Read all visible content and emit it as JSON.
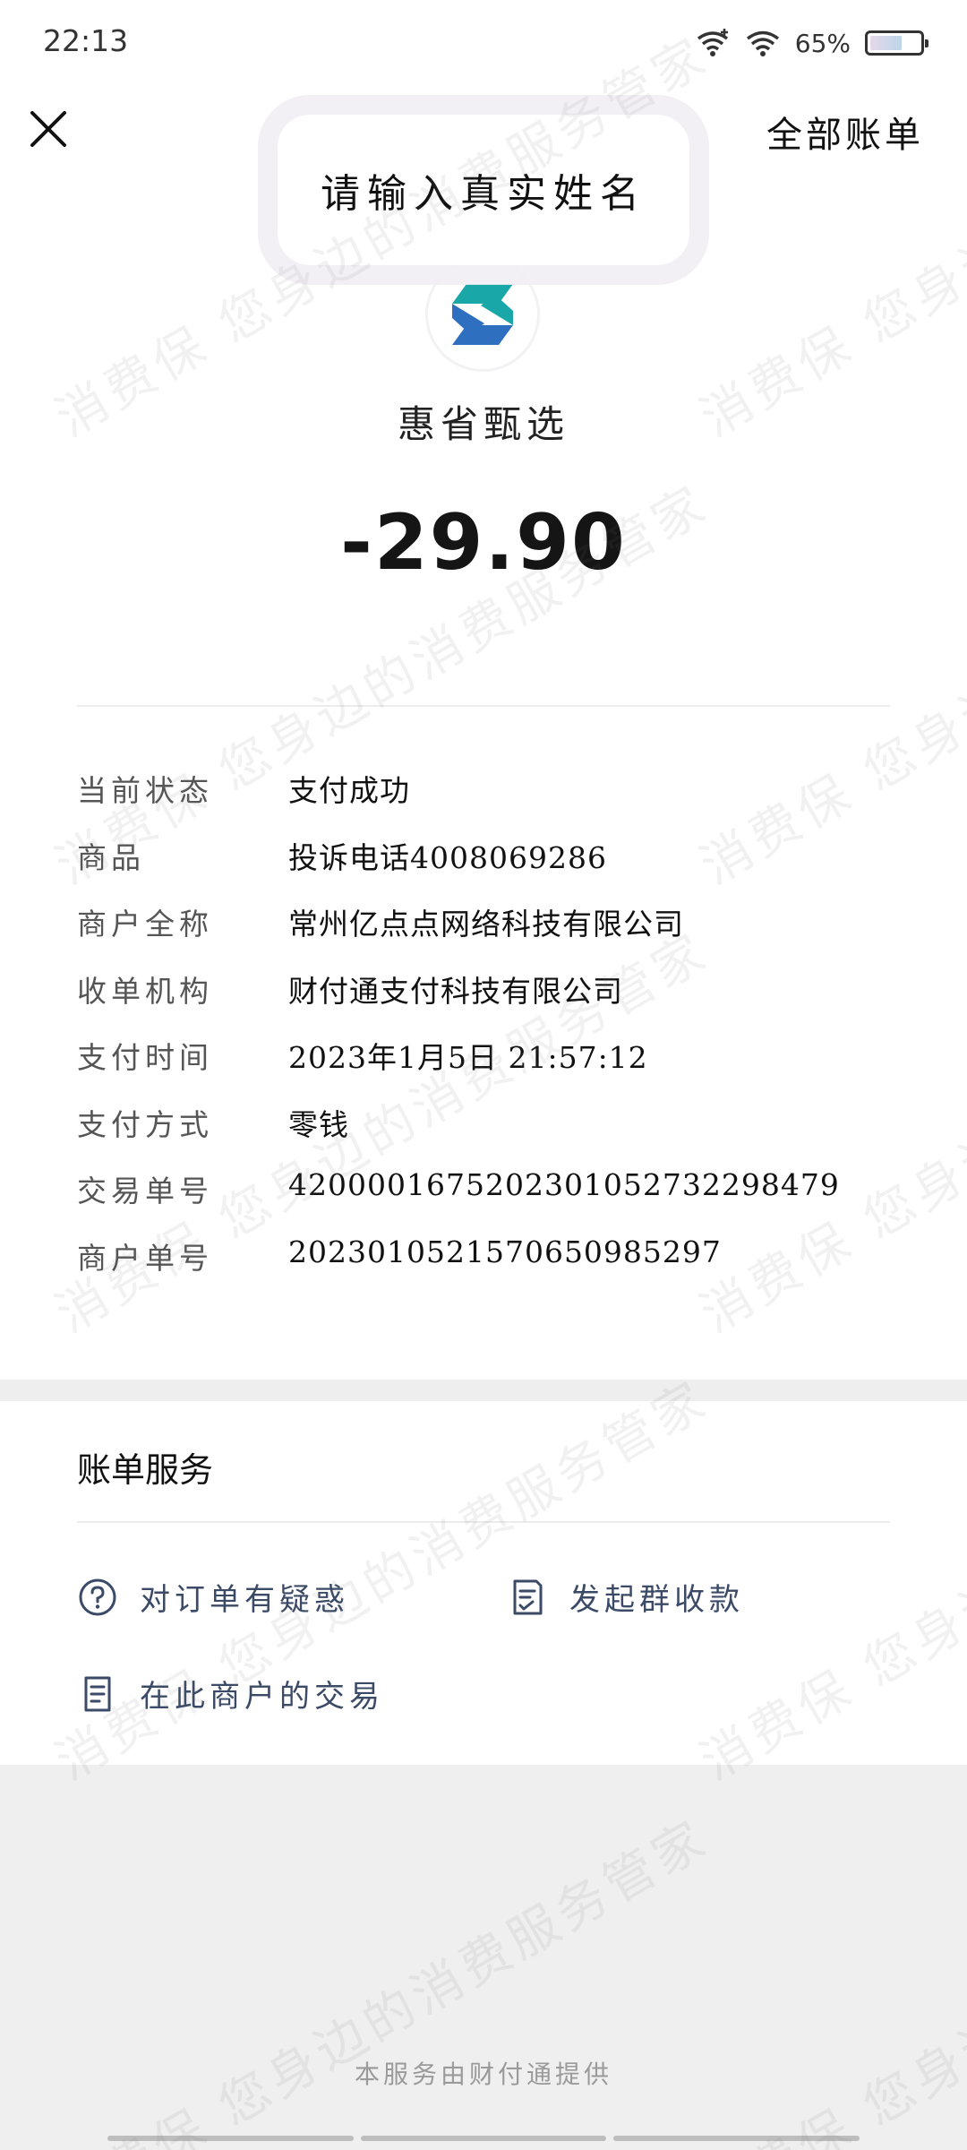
{
  "status_bar": {
    "time": "22:13",
    "battery_percent": "65%",
    "battery_level": 0.65
  },
  "top_bar": {
    "close_icon": "close-icon",
    "all_bills_label": "全部账单"
  },
  "name_popup": {
    "text": "请输入真实姓名"
  },
  "merchant": {
    "name": "惠省甄选",
    "logo_icon": "s-logo-icon"
  },
  "amount": "-29.90",
  "details": [
    {
      "label": "当前状态",
      "value": "支付成功"
    },
    {
      "label": "商品",
      "value": "投诉电话4008069286"
    },
    {
      "label": "商户全称",
      "value": "常州亿点点网络科技有限公司"
    },
    {
      "label": "收单机构",
      "value": "财付通支付科技有限公司"
    },
    {
      "label": "支付时间",
      "value": "2023年1月5日 21:57:12"
    },
    {
      "label": "支付方式",
      "value": "零钱"
    },
    {
      "label": "交易单号",
      "value": "4200001675202301052732298479"
    },
    {
      "label": "商户单号",
      "value": "20230105215706509852​97"
    }
  ],
  "services": {
    "title": "账单服务",
    "items": [
      {
        "label": "对订单有疑惑",
        "icon": "question-circle-icon"
      },
      {
        "label": "发起群收款",
        "icon": "checklist-icon"
      },
      {
        "label": "在此商户的交易",
        "icon": "document-icon"
      }
    ]
  },
  "footer": "本服务由财付通提供",
  "watermark_text": "消费保 您身边的消费服务管家",
  "colors": {
    "service_link": "#3b4a66",
    "logo_teal": "#1aa7a8",
    "logo_blue": "#2f6fc0"
  }
}
